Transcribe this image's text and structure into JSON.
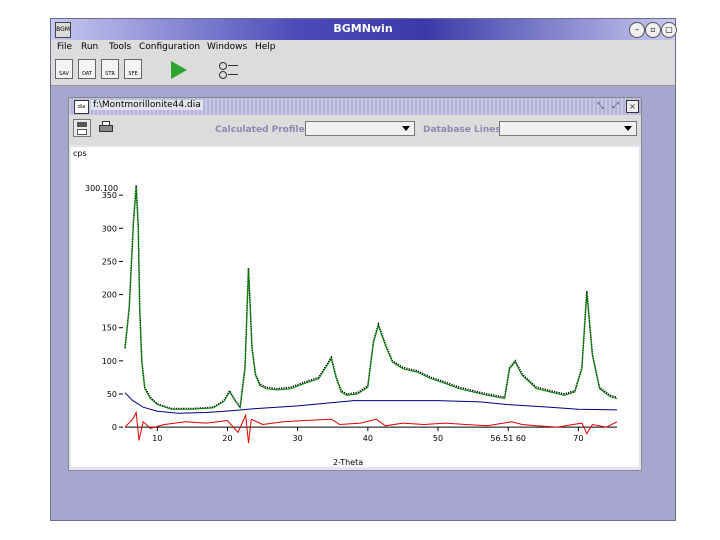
{
  "window": {
    "title": "BGMNwin",
    "app_icon_text": "BGM",
    "controls": [
      "minimize",
      "maximize",
      "close"
    ]
  },
  "menu": {
    "items": [
      "File",
      "Run",
      "Tools",
      "Configuration",
      "Windows",
      "Help"
    ]
  },
  "toolbar": {
    "buttons": [
      {
        "icon": "sav-file-icon",
        "label": "SAV"
      },
      {
        "icon": "dat-file-icon",
        "label": "DAT"
      },
      {
        "icon": "str-file-icon",
        "label": "STR"
      },
      {
        "icon": "sfe-file-icon",
        "label": "SFE"
      }
    ],
    "run_icon": "play-icon",
    "settings_icon": "settings-icon"
  },
  "inner_window": {
    "title": "f:\\Montmorillonite44.dia",
    "calculated_profiles_label": "Calculated Profiles:",
    "calculated_profiles_value": "",
    "database_lines_label": "Database Lines:",
    "database_lines_value": ""
  },
  "chart_data": {
    "type": "line",
    "ylabel": "cps",
    "xlabel": "2-Theta",
    "ylim": [
      -30,
      400
    ],
    "xlim": [
      5.4,
      75.5
    ],
    "yticks": [
      0,
      50,
      100,
      150,
      200,
      250,
      300,
      350
    ],
    "yticks_labels": [
      "0",
      "50",
      "100",
      "150",
      "200",
      "250",
      "300",
      "350"
    ],
    "y_overlay_label": "300.100",
    "xticks": [
      10,
      20,
      30,
      40,
      50,
      60,
      70
    ],
    "xticks_labels": [
      "10",
      "20",
      "30",
      "40",
      "50",
      "56.51 60",
      "70"
    ],
    "series": [
      {
        "color": "#000000",
        "x": [
          5.4,
          6.0,
          6.6,
          7.0,
          7.3,
          7.5,
          7.8,
          8.2,
          9.0,
          10,
          12,
          15,
          18,
          19.5,
          20.3,
          21.0,
          21.8,
          22.5,
          23.0,
          23.5,
          24.0,
          24.6,
          25.5,
          27,
          29,
          31,
          33,
          34.8,
          35.5,
          36.2,
          37,
          38.5,
          40,
          40.8,
          41.5,
          42.5,
          43.5,
          45,
          47,
          49,
          51,
          53,
          55,
          57,
          59.5,
          60.2,
          61,
          62,
          64,
          66,
          68,
          69.5,
          70.5,
          71.2,
          72,
          73,
          74.5,
          75.5
        ],
        "y": [
          120,
          180,
          310,
          365,
          300,
          180,
          100,
          60,
          45,
          35,
          28,
          28,
          30,
          40,
          55,
          42,
          30,
          90,
          240,
          120,
          80,
          65,
          60,
          58,
          60,
          68,
          75,
          105,
          75,
          55,
          50,
          52,
          62,
          130,
          155,
          125,
          100,
          90,
          85,
          75,
          68,
          60,
          55,
          50,
          45,
          90,
          100,
          80,
          60,
          55,
          50,
          55,
          90,
          205,
          110,
          60,
          48,
          45
        ]
      },
      {
        "color": "#008000",
        "x": [
          5.4,
          6.0,
          6.6,
          7.0,
          7.3,
          7.5,
          7.8,
          8.2,
          9.0,
          10,
          12,
          15,
          18,
          19.5,
          20.3,
          21.0,
          21.8,
          22.5,
          23.0,
          23.5,
          24.0,
          24.6,
          25.5,
          27,
          29,
          31,
          33,
          34.8,
          35.5,
          36.2,
          37,
          38.5,
          40,
          40.8,
          41.5,
          42.5,
          43.5,
          45,
          47,
          49,
          51,
          53,
          55,
          57,
          59.5,
          60.2,
          61,
          62,
          64,
          66,
          68,
          69.5,
          70.5,
          71.2,
          72,
          73,
          74.5,
          75.5
        ],
        "y": [
          118,
          178,
          305,
          362,
          298,
          178,
          98,
          58,
          43,
          34,
          27,
          27,
          29,
          39,
          53,
          41,
          29,
          88,
          238,
          118,
          78,
          63,
          58,
          56,
          58,
          66,
          73,
          103,
          73,
          53,
          48,
          50,
          60,
          128,
          153,
          123,
          98,
          88,
          83,
          73,
          66,
          58,
          53,
          48,
          43,
          88,
          98,
          78,
          58,
          53,
          48,
          53,
          88,
          203,
          108,
          58,
          46,
          43
        ]
      },
      {
        "color": "#000080",
        "x": [
          5.4,
          6.5,
          8,
          10,
          13,
          17,
          21,
          24,
          30,
          38,
          44,
          50,
          56,
          60,
          66,
          70,
          75.5
        ],
        "y": [
          52,
          40,
          30,
          24,
          21,
          22,
          25,
          28,
          32,
          40,
          40,
          40,
          38,
          34,
          30,
          27,
          26
        ]
      },
      {
        "color": "#e00000",
        "x": [
          5.4,
          6.5,
          7.0,
          7.4,
          8,
          9,
          11,
          14,
          17,
          20,
          21.5,
          22.6,
          23.0,
          23.4,
          25,
          28,
          31,
          34.8,
          36,
          39,
          41.2,
          42.5,
          45,
          48,
          51,
          54,
          57,
          60.5,
          62,
          64,
          67,
          70.5,
          71.2,
          72,
          74,
          75.5
        ],
        "y": [
          0,
          12,
          22,
          -20,
          8,
          -2,
          4,
          8,
          6,
          10,
          -8,
          18,
          -24,
          12,
          4,
          8,
          10,
          12,
          4,
          6,
          12,
          2,
          6,
          4,
          6,
          4,
          2,
          8,
          4,
          2,
          0,
          6,
          -10,
          4,
          0,
          8
        ]
      }
    ],
    "grid": false,
    "legend": "none"
  }
}
